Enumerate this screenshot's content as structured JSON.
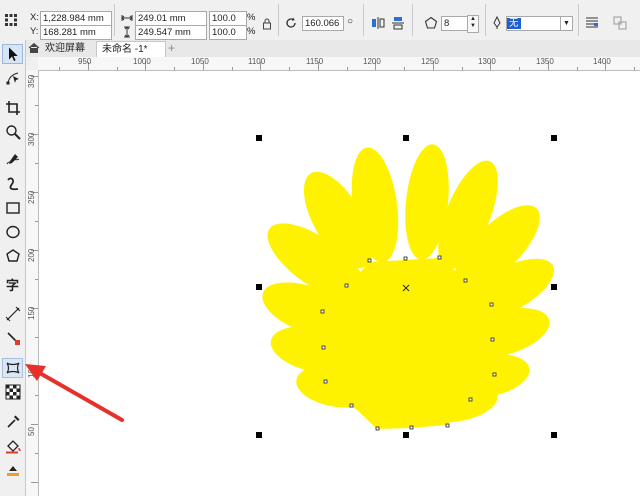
{
  "propbar": {
    "x_label": "X:",
    "x_value": "1,228.984 mm",
    "y_label": "Y:",
    "y_value": "168.281 mm",
    "width_value": "249.01 mm",
    "height_value": "249.547 mm",
    "scale_w": "100.0",
    "scale_h": "100.0",
    "percent": "%",
    "rotation_value": "160.066",
    "degree": "○",
    "sides_value": "8",
    "outline_value": "无"
  },
  "tabs": {
    "welcome": "欢迎屏幕",
    "untitled": "未命名 -1*",
    "add": "+"
  },
  "ruler": {
    "h_ticks": [
      "950",
      "1000",
      "1050",
      "1100",
      "1150",
      "1200",
      "1250",
      "1300",
      "1350",
      "1400"
    ],
    "v_ticks": [
      "350",
      "300",
      "250",
      "200",
      "150",
      "100",
      "50"
    ]
  },
  "toolbox": {
    "text_tool": "字"
  },
  "colors": {
    "shape_fill": "#fff200",
    "arrow": "#e8302a"
  }
}
